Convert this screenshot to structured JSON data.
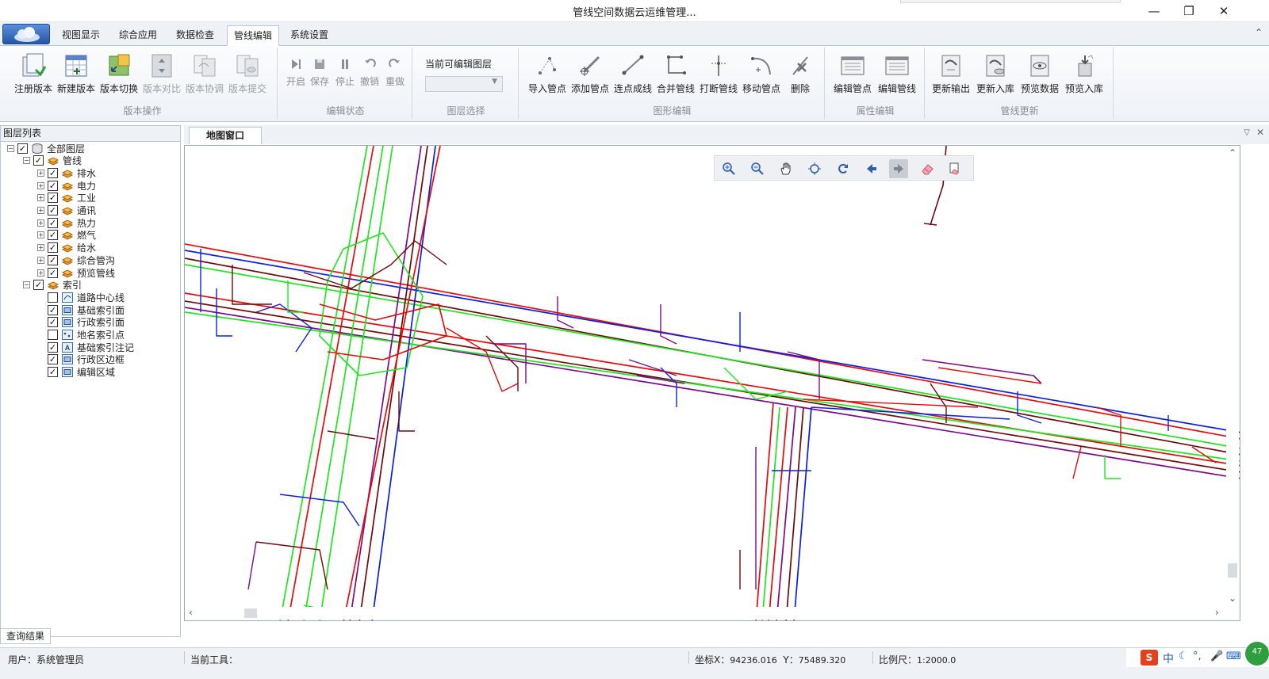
{
  "window": {
    "title": "管线空间数据云运维管理...",
    "controls": [
      "minimize",
      "restore",
      "close"
    ]
  },
  "ribbon": {
    "tabs": [
      "视图显示",
      "综合应用",
      "数据检查",
      "管线编辑",
      "系统设置"
    ],
    "active_tab": "管线编辑",
    "groups": {
      "version": {
        "label": "版本操作",
        "buttons": [
          "注册版本",
          "新建版本",
          "版本切换",
          "版本对比",
          "版本协调",
          "版本提交"
        ]
      },
      "edit_state": {
        "label": "编辑状态",
        "buttons": [
          "开启",
          "保存",
          "停止",
          "撤销",
          "重做"
        ]
      },
      "layer_select": {
        "label": "图层选择",
        "title": "当前可编辑图层",
        "combo_value": ""
      },
      "graphic_edit": {
        "label": "图形编辑",
        "buttons": [
          "导入管点",
          "添加管点",
          "连点成线",
          "合并管线",
          "打断管线",
          "移动管点",
          "删除"
        ]
      },
      "attr_edit": {
        "label": "属性编辑",
        "buttons": [
          "编辑管点",
          "编辑管线"
        ]
      },
      "pipe_update": {
        "label": "管线更新",
        "buttons": [
          "更新输出",
          "更新入库",
          "预览数据",
          "预览入库"
        ]
      }
    }
  },
  "layer_panel": {
    "title": "图层列表",
    "root": {
      "label": "全部图层",
      "checked": true
    },
    "pipeline_group": {
      "label": "管线",
      "checked": true,
      "items": [
        {
          "label": "排水",
          "checked": true
        },
        {
          "label": "电力",
          "checked": true
        },
        {
          "label": "工业",
          "checked": true
        },
        {
          "label": "通讯",
          "checked": true
        },
        {
          "label": "热力",
          "checked": true
        },
        {
          "label": "燃气",
          "checked": true
        },
        {
          "label": "给水",
          "checked": true
        },
        {
          "label": "综合管沟",
          "checked": true
        },
        {
          "label": "预览管线",
          "checked": true
        }
      ]
    },
    "index_group": {
      "label": "索引",
      "checked": true,
      "items": [
        {
          "label": "道路中心线",
          "checked": false,
          "icon": "line-layer-icon"
        },
        {
          "label": "基础索引面",
          "checked": true,
          "icon": "polygon-layer-icon"
        },
        {
          "label": "行政索引面",
          "checked": true,
          "icon": "polygon-layer-icon"
        },
        {
          "label": "地名索引点",
          "checked": false,
          "icon": "point-layer-icon"
        },
        {
          "label": "基础索引注记",
          "checked": true,
          "icon": "annotation-layer-icon"
        },
        {
          "label": "行政区边框",
          "checked": true,
          "icon": "polygon-layer-icon"
        },
        {
          "label": "编辑区域",
          "checked": true,
          "icon": "polygon-layer-icon"
        }
      ]
    }
  },
  "map": {
    "tab_label": "地图窗口",
    "tools": [
      "zoom-in-icon",
      "zoom-out-icon",
      "pan-hand-icon",
      "full-extent-icon",
      "refresh-icon",
      "back-arrow-icon",
      "forward-arrow-icon",
      "eraser-icon",
      "clear-select-icon"
    ],
    "pipe_colors": {
      "water_supply": "#0a1ee6",
      "drainage": "#6e0a0a",
      "power": "#e60a0a",
      "gas": "#1ee61e",
      "telecom": "#7a0a8c"
    }
  },
  "bottom": {
    "results_tab": "查询结果"
  },
  "status": {
    "user_label": "用户：",
    "user_value": "系统管理员",
    "tool_label": "当前工具：",
    "tool_value": "",
    "coord_x_label": "坐标X：",
    "coord_x": "94236.016",
    "coord_y_label": "Y：",
    "coord_y": "75489.320",
    "scale_label": "比例尺：",
    "scale_value": "1:2000.0"
  },
  "ime": {
    "label": "中",
    "badge": "47"
  }
}
